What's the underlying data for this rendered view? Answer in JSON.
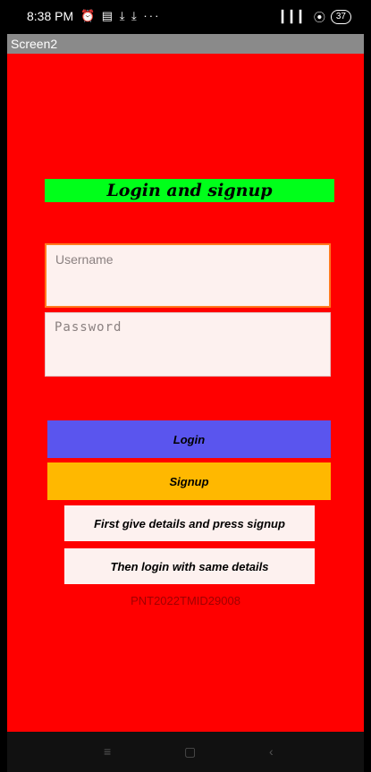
{
  "status": {
    "time": "8:38 PM",
    "left_icons": "⏰ ▤ ⤓ ⤓ ···",
    "signal": "▎▎▎",
    "wifi": "⦿",
    "battery": "37"
  },
  "app": {
    "title": "Screen2"
  },
  "form": {
    "heading": "Login and signup",
    "username_placeholder": "Username",
    "password_placeholder": "Password",
    "login_label": "Login",
    "signup_label": "Signup",
    "note1": "First give details and press signup",
    "note2": "Then login with same details",
    "id_text": "PNT2022TMID29008"
  },
  "navbar": {
    "menu_icon": "≡",
    "home_icon": "▢",
    "back_icon": "‹"
  },
  "colors": {
    "background": "#ff0000",
    "heading_bg": "#00ff1a",
    "login_bg": "#5a55ee",
    "signup_bg": "#ffb800",
    "field_bg": "#fdf1ef"
  }
}
